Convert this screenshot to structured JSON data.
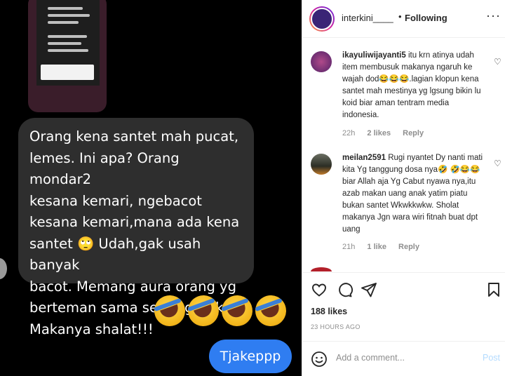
{
  "chat": {
    "message": "Orang kena santet mah pucat,\nlemes. Ini apa? Orang mondar2\nkesana kemari, ngebacot\nkesana kemari,mana ada kena\nsantet 🙄 Udah,gak usah banyak\nbacot. Memang aura orang yg\nberteman sama setan gitu kok.\nMakanya shalat!!!",
    "emojis": [
      "rolling-on-floor-laughing",
      "rolling-on-floor-laughing",
      "rolling-on-floor-laughing",
      "rolling-on-floor-laughing"
    ],
    "sent_message": "Tjakeppp"
  },
  "post": {
    "username": "interkini____",
    "separator": "•",
    "following_label": "Following",
    "more_icon": "more-horizontal-icon"
  },
  "comments": [
    {
      "user": "ikayuliwijayanti5",
      "text": "itu krn atinya udah item membusuk makanya ngaruh ke wajah dod😂😂😂.lagian klopun kena santet mah mestinya yg lgsung bikin lu koid biar aman tentram media indonesia.",
      "time": "22h",
      "likes": "2 likes",
      "reply": "Reply"
    },
    {
      "user": "meilan2591",
      "text": "Rugi nyantet Dy nanti mati kita Yg tanggung dosa nya🤣 🤣😂😂biar Allah aja Yg Cabut nyawa nya,itu azab makan uang anak yatim piatu bukan santet Wkwkkwkw. Sholat makanya Jgn wara wiri fitnah buat dpt uang",
      "time": "21h",
      "likes": "1 like",
      "reply": "Reply"
    }
  ],
  "actions": {
    "likes": "188 likes",
    "time_ago": "23 HOURS AGO"
  },
  "add_comment": {
    "placeholder": "Add a comment...",
    "post_label": "Post"
  },
  "colors": {
    "sent_bubble": "#2f7df1",
    "received_bubble": "#2e2e2e",
    "post_disabled": "#b3dbff"
  }
}
